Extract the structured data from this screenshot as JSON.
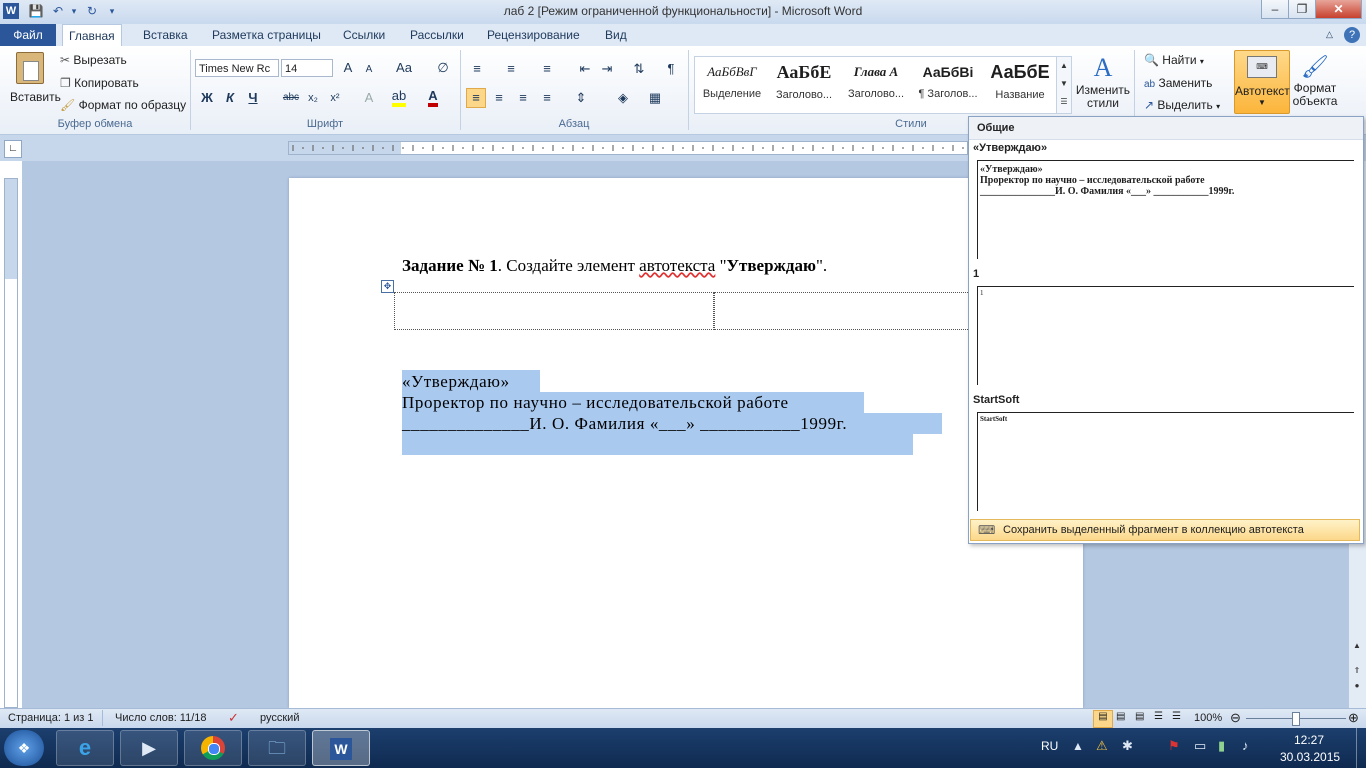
{
  "window": {
    "title": "лаб 2 [Режим ограниченной функциональности]  -  Microsoft Word",
    "app_icon": "W"
  },
  "tabs": [
    "Файл",
    "Главная",
    "Вставка",
    "Разметка страницы",
    "Ссылки",
    "Рассылки",
    "Рецензирование",
    "Вид"
  ],
  "ribbon": {
    "clipboard": {
      "paste": "Вставить",
      "cut": "Вырезать",
      "copy": "Копировать",
      "format_painter": "Формат по образцу",
      "label": "Буфер обмена"
    },
    "font": {
      "name": "Times New Rc",
      "size": "14",
      "grow": "A",
      "shrink": "A",
      "case": "Aa",
      "bold": "Ж",
      "italic": "К",
      "underline": "Ч",
      "strike": "abc",
      "sub": "x₂",
      "sup": "x²",
      "color_letter": "A",
      "label": "Шрифт"
    },
    "paragraph": {
      "label": "Абзац",
      "pilcrow": "¶"
    },
    "styles": {
      "items": [
        {
          "preview": "АаБбВвГ",
          "label": "Выделение"
        },
        {
          "preview": "АаБбЕ",
          "label": "Заголово..."
        },
        {
          "preview": "Глава  А",
          "label": "Заголово..."
        },
        {
          "preview": "АаБбВі",
          "label": "¶ Заголов..."
        },
        {
          "preview": "АаБбЕ",
          "label": "Название"
        }
      ],
      "change_styles": "Изменить стили",
      "label": "Стили"
    },
    "editing": {
      "find": "Найти",
      "replace": "Заменить",
      "select": "Выделить"
    },
    "autotext": "Автотекст",
    "object_format": "Формат объекта"
  },
  "document": {
    "task_bold": "Задание № 1",
    "task_rest": ". Создайте элемент ",
    "task_word": "автотекста",
    "task_quote_open": " \"",
    "task_quote_bold": "Утверждаю",
    "task_quote_close": "\".",
    "block_line1": "«Утверждаю»",
    "block_line2": "Проректор по научно – исследовательской  работе",
    "block_line3": "______________И. О. Фамилия «___» ___________1999г."
  },
  "gallery": {
    "section": "Общие",
    "entries": [
      {
        "name": "«Утверждаю»",
        "preview": [
          "«Утверждаю»",
          "Проректор  по  научно  –  исследовательской  работе",
          "_______________И. О.  Фамилия  «___»  ___________1999г."
        ]
      },
      {
        "name": "1",
        "preview": [
          "1"
        ]
      },
      {
        "name": "StartSoft",
        "preview": [
          "StartSoft"
        ]
      }
    ],
    "save_action": "Сохранить выделенный фрагмент в коллекцию автотекста"
  },
  "status": {
    "page": "Страница: 1 из 1",
    "words": "Число слов: 11/18",
    "language": "русский",
    "zoom": "100%"
  },
  "taskbar": {
    "lang": "RU",
    "time": "12:27",
    "date": "30.03.2015"
  }
}
